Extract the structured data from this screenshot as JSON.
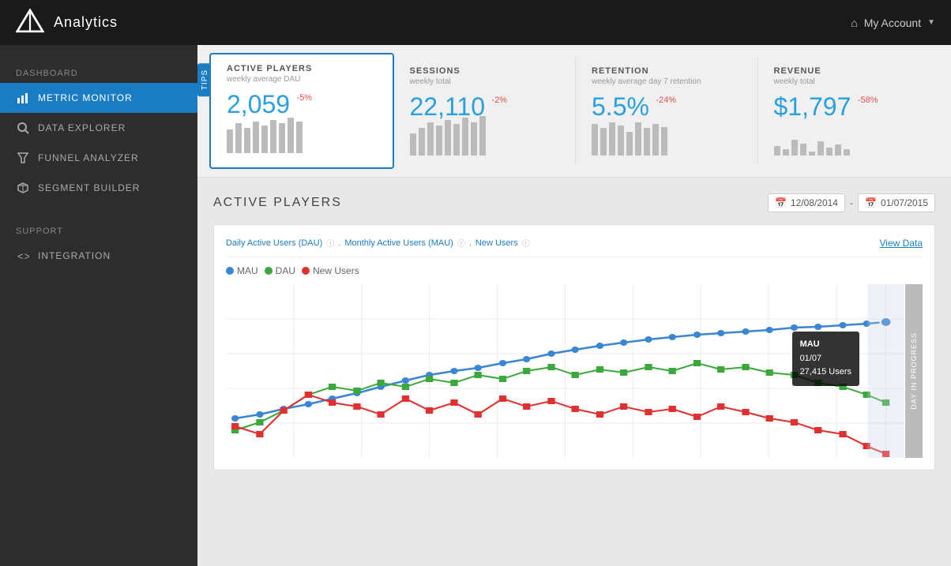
{
  "topnav": {
    "title": "Analytics",
    "account_label": "My Account",
    "home_icon": "⌂"
  },
  "sidebar": {
    "section_dashboard": "Dashboard",
    "items": [
      {
        "id": "metric-monitor",
        "label": "Metric Monitor",
        "icon": "bar",
        "active": true
      },
      {
        "id": "data-explorer",
        "label": "Data Explorer",
        "icon": "search",
        "active": false
      },
      {
        "id": "funnel-analyzer",
        "label": "Funnel Analyzer",
        "icon": "funnel",
        "active": false
      },
      {
        "id": "segment-builder",
        "label": "Segment Builder",
        "icon": "cube",
        "active": false
      }
    ],
    "section_support": "Support",
    "support_items": [
      {
        "id": "integration",
        "label": "Integration",
        "icon": "brackets",
        "active": false
      }
    ]
  },
  "tips_tab": "Tips",
  "metrics": {
    "cards": [
      {
        "id": "active-players",
        "title": "ACTIVE PLAYERS",
        "subtitle": "weekly average DAU",
        "value": "2,059",
        "change": "-5%",
        "bars": [
          30,
          38,
          32,
          40,
          35,
          42,
          38,
          45,
          40
        ]
      },
      {
        "id": "sessions",
        "title": "SESSIONS",
        "subtitle": "weekly total",
        "value": "22,110",
        "change": "-2%",
        "bars": [
          28,
          35,
          42,
          38,
          45,
          40,
          48,
          42,
          50
        ]
      },
      {
        "id": "retention",
        "title": "RETENTION",
        "subtitle": "weekly average day 7 retention",
        "value": "5.5%",
        "change": "-24%",
        "bars": [
          40,
          35,
          42,
          38,
          30,
          42,
          35,
          40,
          36
        ]
      },
      {
        "id": "revenue",
        "title": "REVENUE",
        "subtitle": "weekly total",
        "value": "$1,797",
        "change": "-58%",
        "bars": [
          12,
          8,
          20,
          15,
          5,
          18,
          10,
          14,
          8
        ]
      }
    ]
  },
  "section": {
    "title": "ACTIVE PLAYERS",
    "date_from": "12/08/2014",
    "date_to": "01/07/2015",
    "date_separator": "-",
    "chart_labels": {
      "dau": "Daily Active Users (DAU)",
      "mau": "Monthly Active Users (MAU)",
      "new_users": "New Users",
      "view_data": "View Data"
    },
    "legend": [
      {
        "id": "mau",
        "label": "MAU",
        "color": "blue"
      },
      {
        "id": "dau",
        "label": "DAU",
        "color": "green"
      },
      {
        "id": "new-users",
        "label": "New Users",
        "color": "red"
      }
    ],
    "tooltip": {
      "label": "MAU",
      "date": "01/07",
      "value": "27,415 Users"
    },
    "in_progress_label": "DAY IN PROGRESS"
  }
}
